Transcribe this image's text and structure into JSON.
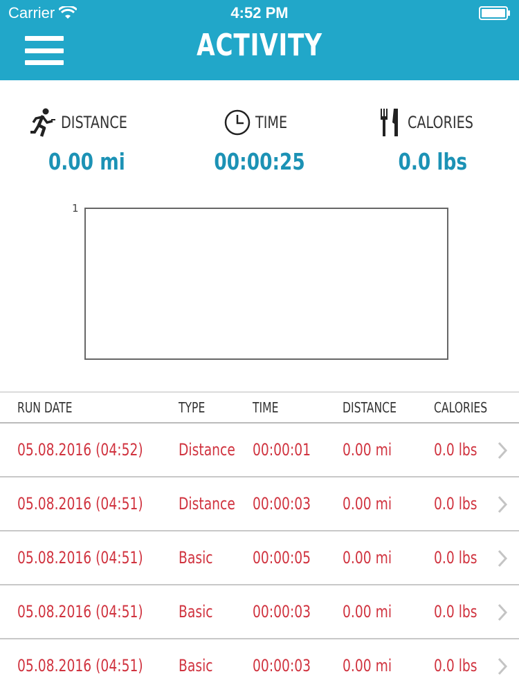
{
  "status_bar": {
    "carrier": "Carrier",
    "time": "4:52 PM"
  },
  "header": {
    "title": "ACTIVITY",
    "background_color": "#21a7c9"
  },
  "stats": [
    {
      "icon": "runner-icon",
      "label": "DISTANCE",
      "value": "0.00 mi"
    },
    {
      "icon": "clock-icon",
      "label": "TIME",
      "value": "00:00:25"
    },
    {
      "icon": "fork-knife-icon",
      "label": "CALORIES",
      "value": "0.0 lbs"
    }
  ],
  "chart": {
    "y_tick": "1"
  },
  "chart_data": {
    "type": "line",
    "x": [],
    "values": [],
    "ylim": [
      0,
      1
    ],
    "y_ticks": [
      "1"
    ],
    "grid": false
  },
  "table": {
    "headers": [
      "RUN DATE",
      "TYPE",
      "TIME",
      "DISTANCE",
      "CALORIES"
    ],
    "rows": [
      [
        "05.08.2016 (04:52)",
        "Distance",
        "00:00:01",
        "0.00 mi",
        "0.0 lbs"
      ],
      [
        "05.08.2016 (04:51)",
        "Distance",
        "00:00:03",
        "0.00 mi",
        "0.0 lbs"
      ],
      [
        "05.08.2016 (04:51)",
        "Basic",
        "00:00:05",
        "0.00 mi",
        "0.0 lbs"
      ],
      [
        "05.08.2016 (04:51)",
        "Basic",
        "00:00:03",
        "0.00 mi",
        "0.0 lbs"
      ],
      [
        "05.08.2016 (04:51)",
        "Basic",
        "00:00:03",
        "0.00 mi",
        "0.0 lbs"
      ]
    ],
    "row_text_color": "#d0333f"
  }
}
